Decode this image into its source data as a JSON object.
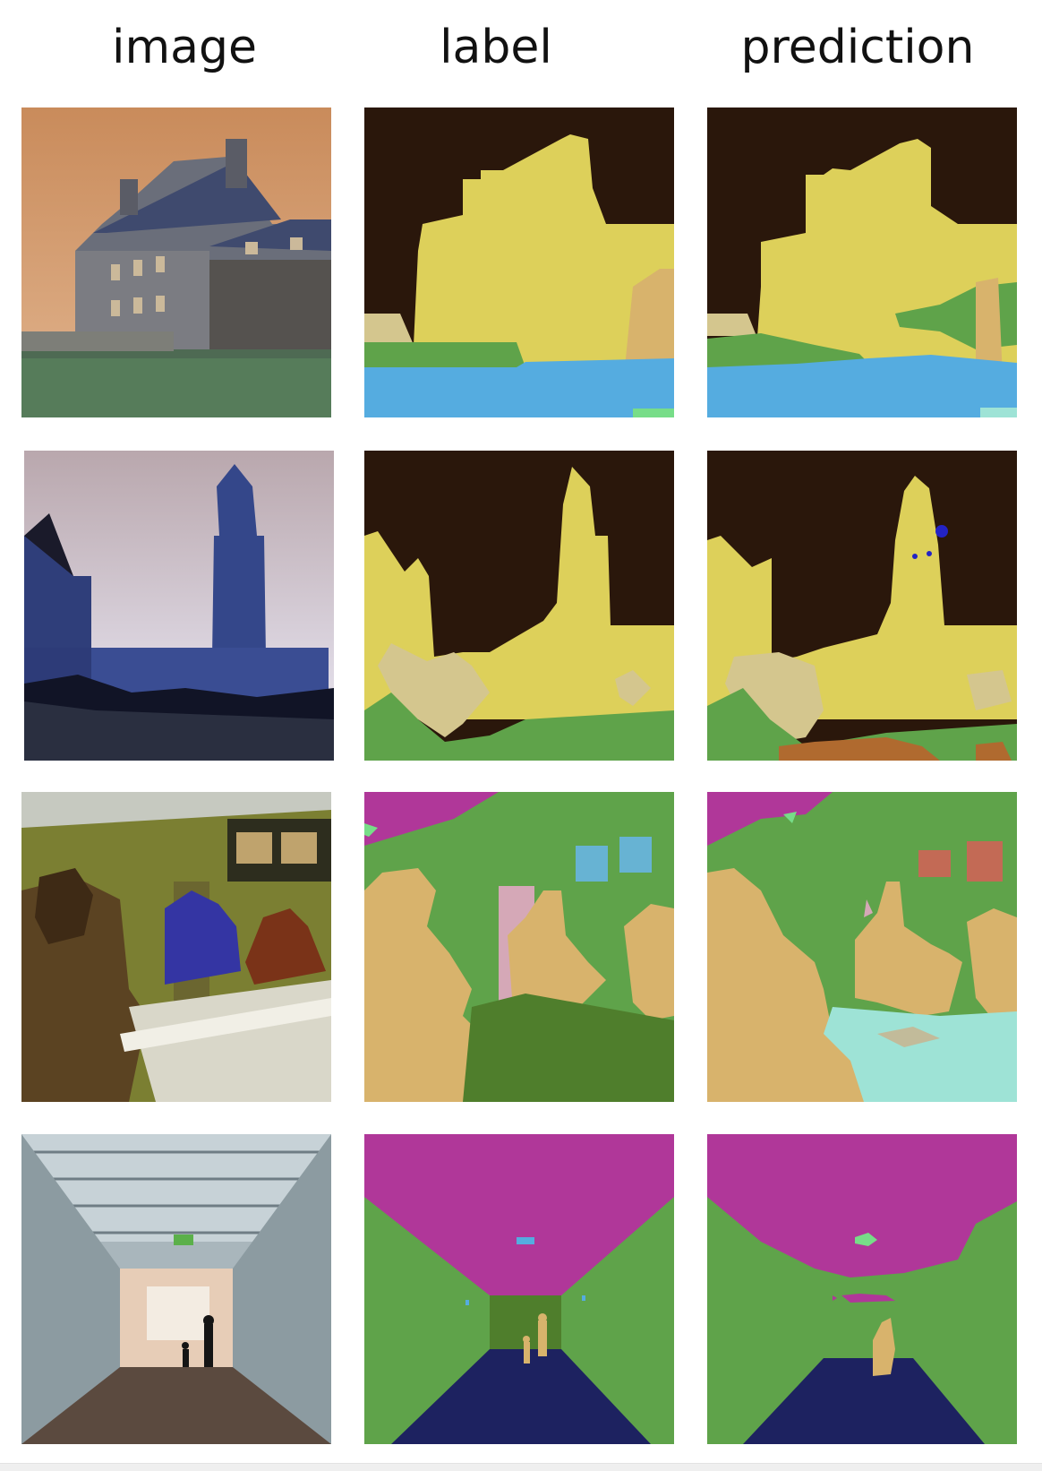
{
  "headers": {
    "image": "image",
    "label": "label",
    "prediction": "prediction"
  },
  "colors": {
    "seg_sky_dark": "#2a170b",
    "seg_building": "#ddd05a",
    "seg_grass": "#5fa34a",
    "seg_water": "#55ace0",
    "seg_tree": "#d4c68e",
    "seg_wall": "#5fa34a",
    "seg_ceiling": "#b03799",
    "seg_person": "#d8b36c",
    "seg_floor": "#1d2260",
    "seg_table": "#4f7e2c",
    "seg_window": "#67b3d3",
    "seg_door": "#d5a8b7",
    "seg_counter": "#9ee3d6",
    "seg_mirror": "#c36a55",
    "seg_earth": "#b06a2f",
    "seg_light": "#77dd88"
  }
}
